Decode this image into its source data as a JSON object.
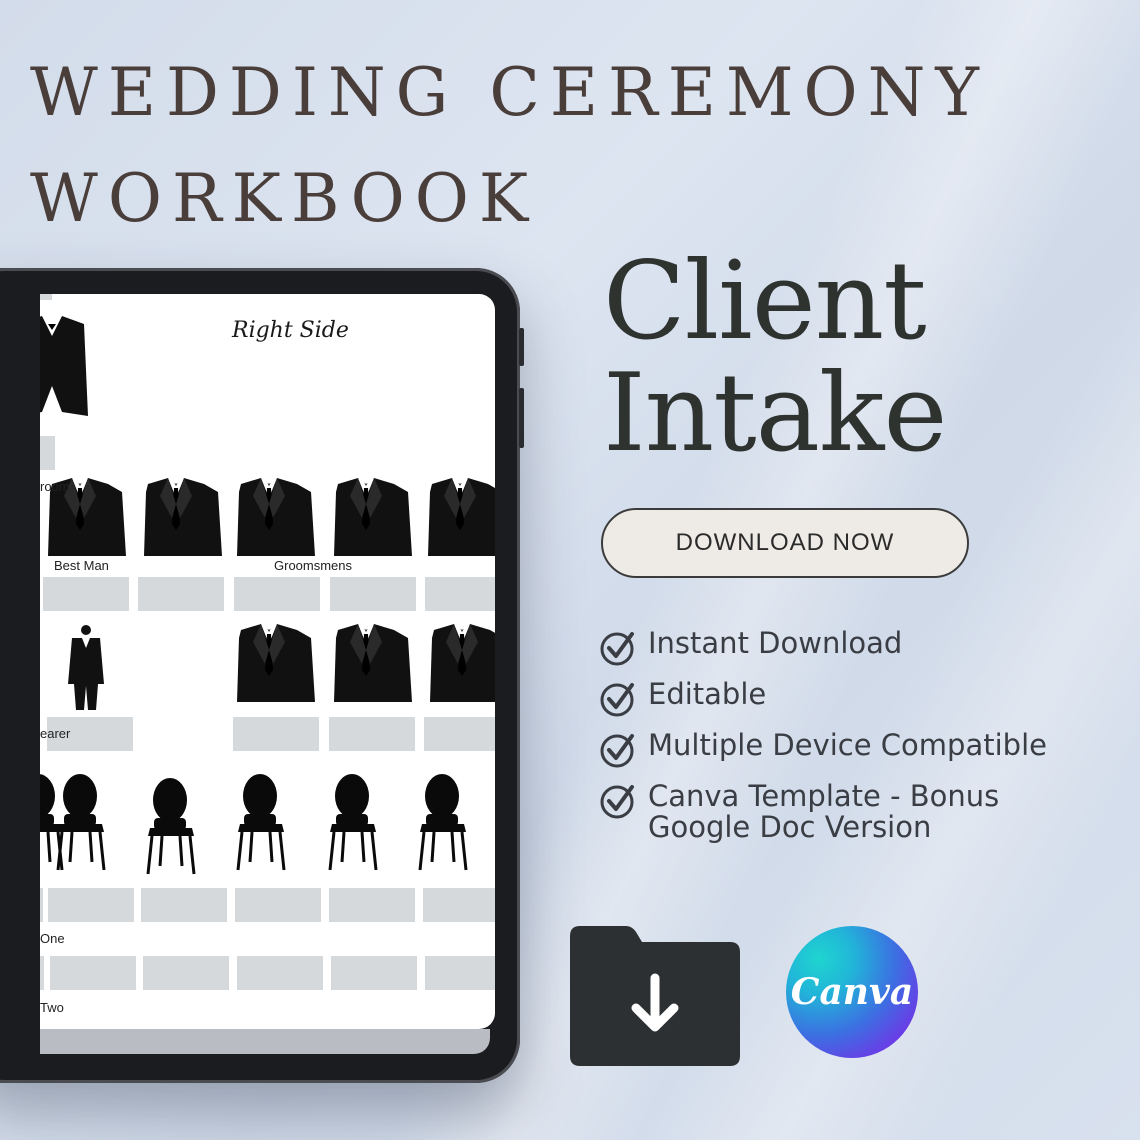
{
  "header": {
    "line1": "WEDDING CEREMONY",
    "line2": "WORKBOOK"
  },
  "product": {
    "title_line1": "Client",
    "title_line2": "Intake",
    "download_label": "DOWNLOAD NOW"
  },
  "features": [
    "Instant Download",
    "Editable",
    "Multiple Device Compatible",
    "Canva Template - Bonus\nGoogle Doc Version"
  ],
  "tablet_screen": {
    "heading": "Right Side",
    "labels": {
      "groom": "room",
      "best_man": "Best Man",
      "groomsmens": "Groomsmens",
      "ring_bearer": "earer",
      "row_one": "One",
      "row_two": "Two"
    }
  },
  "brand": {
    "canva_label": "Canva"
  },
  "icons": {
    "checks": "check-circle-icon",
    "folder": "folder-download-icon",
    "canva": "canva-logo"
  },
  "colors": {
    "background": "#d6dfec",
    "headline": "#4a3e3b",
    "title": "#2f3330",
    "button_bg": "#eeebe6",
    "folder": "#2c3032"
  }
}
